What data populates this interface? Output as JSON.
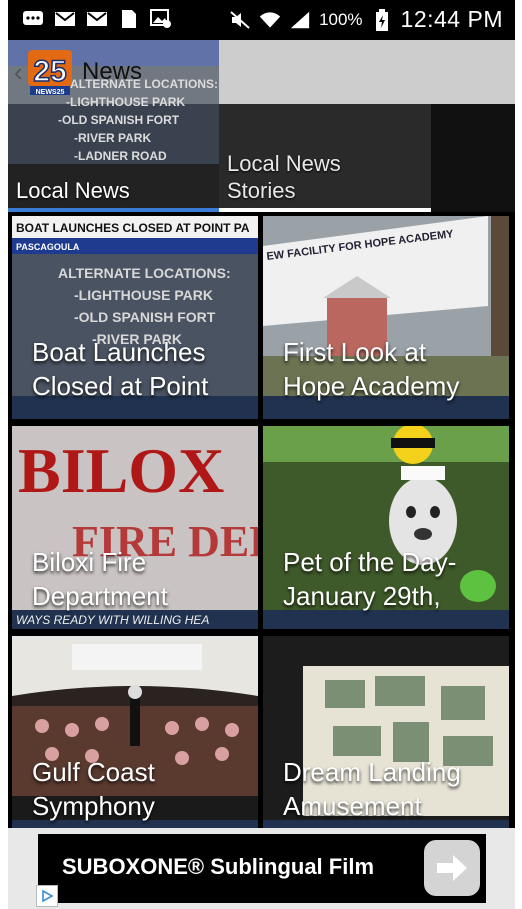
{
  "status_bar": {
    "battery_percent": "100%",
    "time": "12:44 PM",
    "left_icons": [
      "chat-icon",
      "mail-icon",
      "mail-icon",
      "sim-icon",
      "image-icon"
    ],
    "right_icons": [
      "mute-icon",
      "wifi-icon",
      "signal-icon",
      "battery-icon"
    ]
  },
  "app_bar": {
    "title": "News",
    "logo_text": "25",
    "logo_sub": "NEWS25"
  },
  "tabs": [
    {
      "label": "Local News",
      "selected": true
    },
    {
      "label": "Local News\nStories",
      "selected": false
    }
  ],
  "stories": [
    {
      "title": "Boat Launches\nClosed at Point",
      "thumb": "boat-launch-graphic"
    },
    {
      "title": "First Look at\nHope Academy",
      "thumb": "hope-academy-sign"
    },
    {
      "title": "Biloxi Fire\nDepartment",
      "thumb": "biloxi-fire-sign"
    },
    {
      "title": "Pet of the Day-\nJanuary 29th,",
      "thumb": "pet-of-the-day"
    },
    {
      "title": "Gulf Coast\nSymphony",
      "thumb": "symphony-stage"
    },
    {
      "title": "Dream Landing\nAmusement",
      "thumb": "dream-landing-board"
    }
  ],
  "thumbnail_text": {
    "boat_headline": "BOAT LAUNCHES CLOSED AT POINT PA",
    "boat_location": "PASCAGOULA",
    "boat_alt_heading": "ALTERNATE LOCATIONS:",
    "boat_alt_1": "-LIGHTHOUSE PARK",
    "boat_alt_2": "-OLD SPANISH FORT",
    "boat_alt_3": "-RIVER PARK",
    "boat_alt_4": "-LADNER ROAD",
    "hope_sign": "EW FACILITY FOR HOPE ACADEMY",
    "biloxi_sign": "BILOX",
    "biloxi_sign_2": "FIRE DEPT",
    "biloxi_ticker": "WAYS READY WITH WILLING HEA"
  },
  "ad": {
    "text": "SUBOXONE® Sublingual Film"
  },
  "colors": {
    "tab_indicator": "#3a7bd5",
    "action_bar": "#dcdcdc",
    "background": "#000000"
  }
}
